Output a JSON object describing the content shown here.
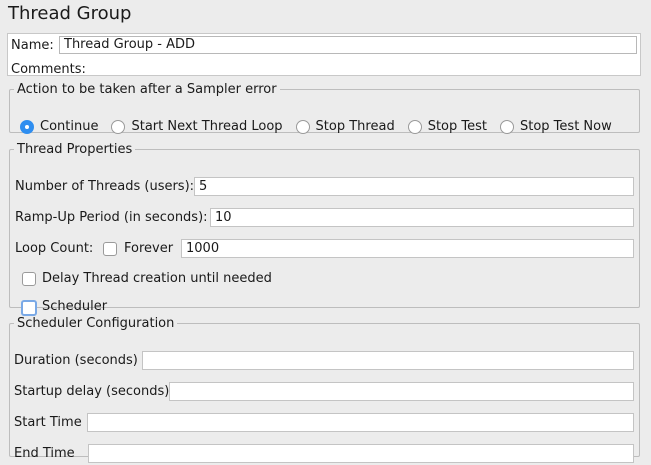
{
  "header": {
    "title": "Thread Group"
  },
  "name_panel": {
    "name_label": "Name:",
    "name_value": "Thread Group - ADD",
    "comments_label": "Comments:"
  },
  "sampler_error": {
    "legend": "Action to be taken after a Sampler error",
    "options": [
      {
        "label": "Continue",
        "selected": true
      },
      {
        "label": "Start Next Thread Loop",
        "selected": false
      },
      {
        "label": "Stop Thread",
        "selected": false
      },
      {
        "label": "Stop Test",
        "selected": false
      },
      {
        "label": "Stop Test Now",
        "selected": false
      }
    ]
  },
  "thread_properties": {
    "legend": "Thread Properties",
    "threads_label": "Number of Threads (users):",
    "threads_value": "5",
    "rampup_label": "Ramp-Up Period (in seconds):",
    "rampup_value": "10",
    "loop_label": "Loop Count:",
    "forever_label": "Forever",
    "forever_checked": false,
    "loop_value": "1000",
    "delay_label": "Delay Thread creation until needed",
    "delay_checked": false,
    "scheduler_label": "Scheduler",
    "scheduler_checked": false
  },
  "scheduler_config": {
    "legend": "Scheduler Configuration",
    "duration_label": "Duration (seconds)",
    "duration_value": "",
    "startup_label": "Startup delay (seconds)",
    "startup_value": "",
    "start_label": "Start Time",
    "start_value": "",
    "end_label": "End Time",
    "end_value": ""
  }
}
